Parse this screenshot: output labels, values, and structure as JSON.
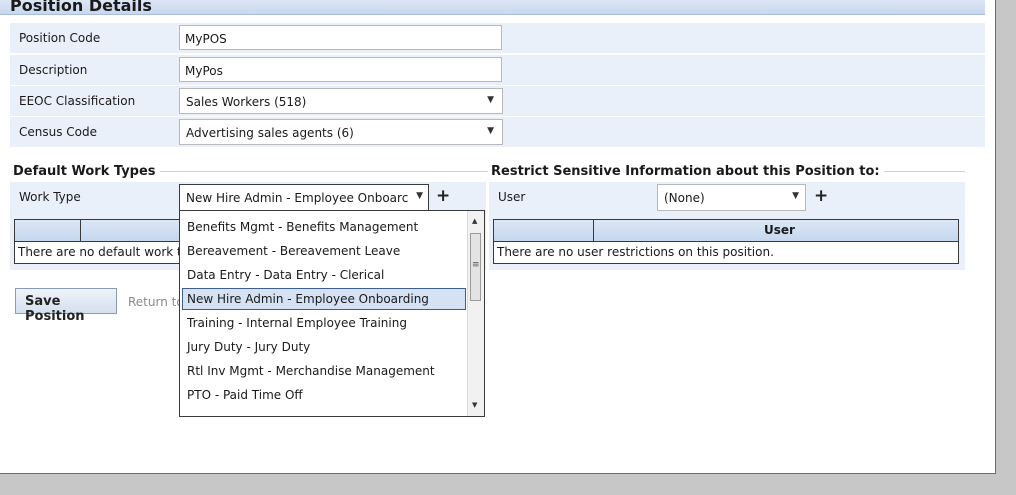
{
  "section_title": "Position Details",
  "fields": [
    {
      "label": "Position Code",
      "value": "MyPOS",
      "kind": "text"
    },
    {
      "label": "Description",
      "value": "MyPos",
      "kind": "text"
    },
    {
      "label": "EEOC Classification",
      "value": "Sales Workers (518)",
      "kind": "select"
    },
    {
      "label": "Census Code",
      "value": "Advertising sales agents (6)",
      "kind": "select"
    }
  ],
  "work_types": {
    "title": "Default Work Types",
    "label": "Work Type",
    "selected": "New Hire Admin - Employee Onboarc",
    "empty_text": "There are no default work type",
    "options": [
      "Benefits Mgmt - Benefits Management",
      "Bereavement - Bereavement Leave",
      "Data Entry - Data Entry - Clerical",
      "New Hire Admin - Employee Onboarding",
      "Training - Internal Employee Training",
      "Jury Duty - Jury Duty",
      "Rtl Inv Mgmt - Merchandise Management",
      "PTO - Paid Time Off"
    ],
    "highlighted_option_index": 3
  },
  "restrict": {
    "title": "Restrict Sensitive Information about this Position to:",
    "label": "User",
    "selected": "(None)",
    "column_header": "User",
    "empty_text": "There are no user restrictions on this position."
  },
  "actions": {
    "save_label": "Save Position",
    "return_label": "Return to"
  },
  "icons": {
    "add": "+",
    "dropdown_arrow": "▼",
    "scroll_up": "▲",
    "scroll_down": "▼",
    "scroll_grip": "≡"
  }
}
